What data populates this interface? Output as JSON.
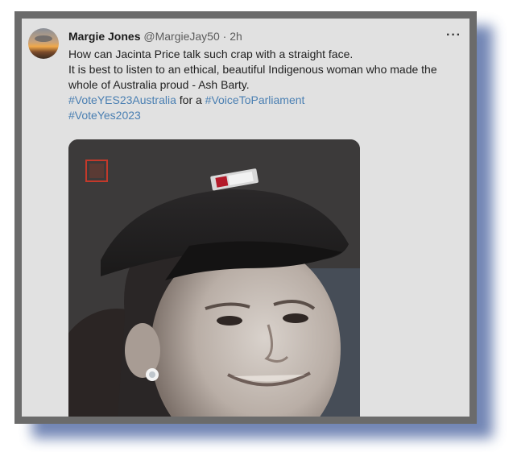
{
  "tweet": {
    "author_name": "Margie Jones",
    "handle": "@MargieJay50",
    "separator": "·",
    "time": "2h",
    "more_label": "···",
    "line1": "How can Jacinta Price talk such crap with a straight face.",
    "line2": "It is best to listen to an ethical, beautiful Indigenous woman who made the whole of Australia proud - Ash Barty.",
    "hashtag1": "#VoteYES23Australia",
    "connector": " for a ",
    "hashtag2": "#VoiceToParliament",
    "hashtag3": "#VoteYes2023"
  },
  "media": {
    "description_icon": "photo-of-smiling-woman-in-cap"
  },
  "colors": {
    "link": "#4a7fb2",
    "card_bg": "#e1e1e1",
    "frame": "#6b6b6b",
    "shadow": "#5a71a8"
  }
}
